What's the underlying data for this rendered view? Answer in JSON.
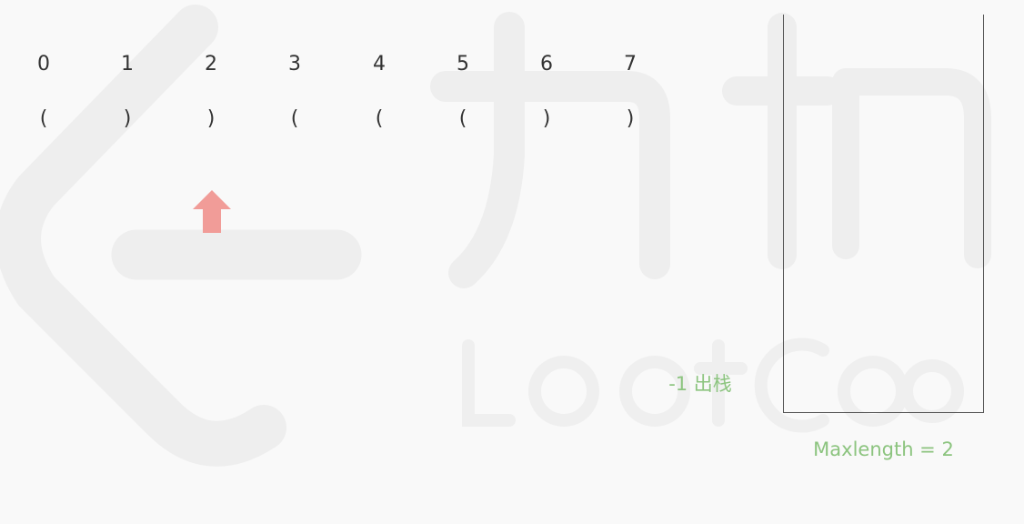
{
  "indices": [
    "0",
    "1",
    "2",
    "3",
    "4",
    "5",
    "6",
    "7"
  ],
  "string": [
    "(",
    ")",
    ")",
    "(",
    "(",
    "(",
    ")",
    ")"
  ],
  "pointer_index": 2,
  "stack_items": [],
  "operation_label": "-1 出栈",
  "maxlength_label": "Maxlength = 2",
  "watermark_text": "力扣 LeetCode",
  "colors": {
    "background": "#f9f9f9",
    "text": "#333333",
    "pointer": "#f19c98",
    "annotation": "#8cc47f",
    "stack_border": "#555555"
  }
}
